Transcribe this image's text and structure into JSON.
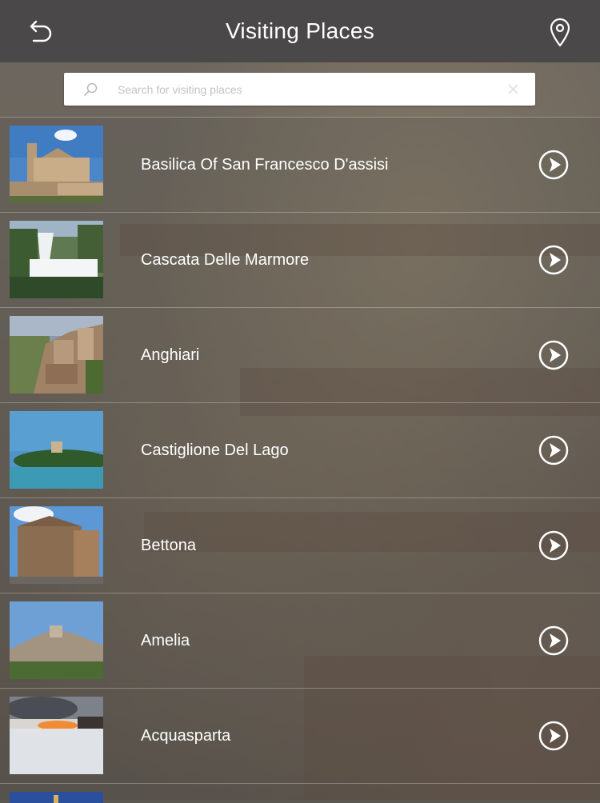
{
  "header": {
    "title": "Visiting Places",
    "back_icon": "back-arrow-icon",
    "map_icon": "location-pin-icon"
  },
  "search": {
    "placeholder": "Search for visiting places",
    "value": ""
  },
  "places": [
    {
      "name": "Basilica Of San Francesco D'assisi",
      "thumb": "basilica"
    },
    {
      "name": "Cascata Delle Marmore",
      "thumb": "waterfall"
    },
    {
      "name": "Anghiari",
      "thumb": "town"
    },
    {
      "name": "Castiglione Del Lago",
      "thumb": "lake"
    },
    {
      "name": "Bettona",
      "thumb": "buildings"
    },
    {
      "name": "Amelia",
      "thumb": "hilltown"
    },
    {
      "name": "Acquasparta",
      "thumb": "sunset-snow"
    }
  ],
  "colors": {
    "header_bg": "#4a4848",
    "text": "#ffffff",
    "placeholder": "#c3c3c3"
  }
}
